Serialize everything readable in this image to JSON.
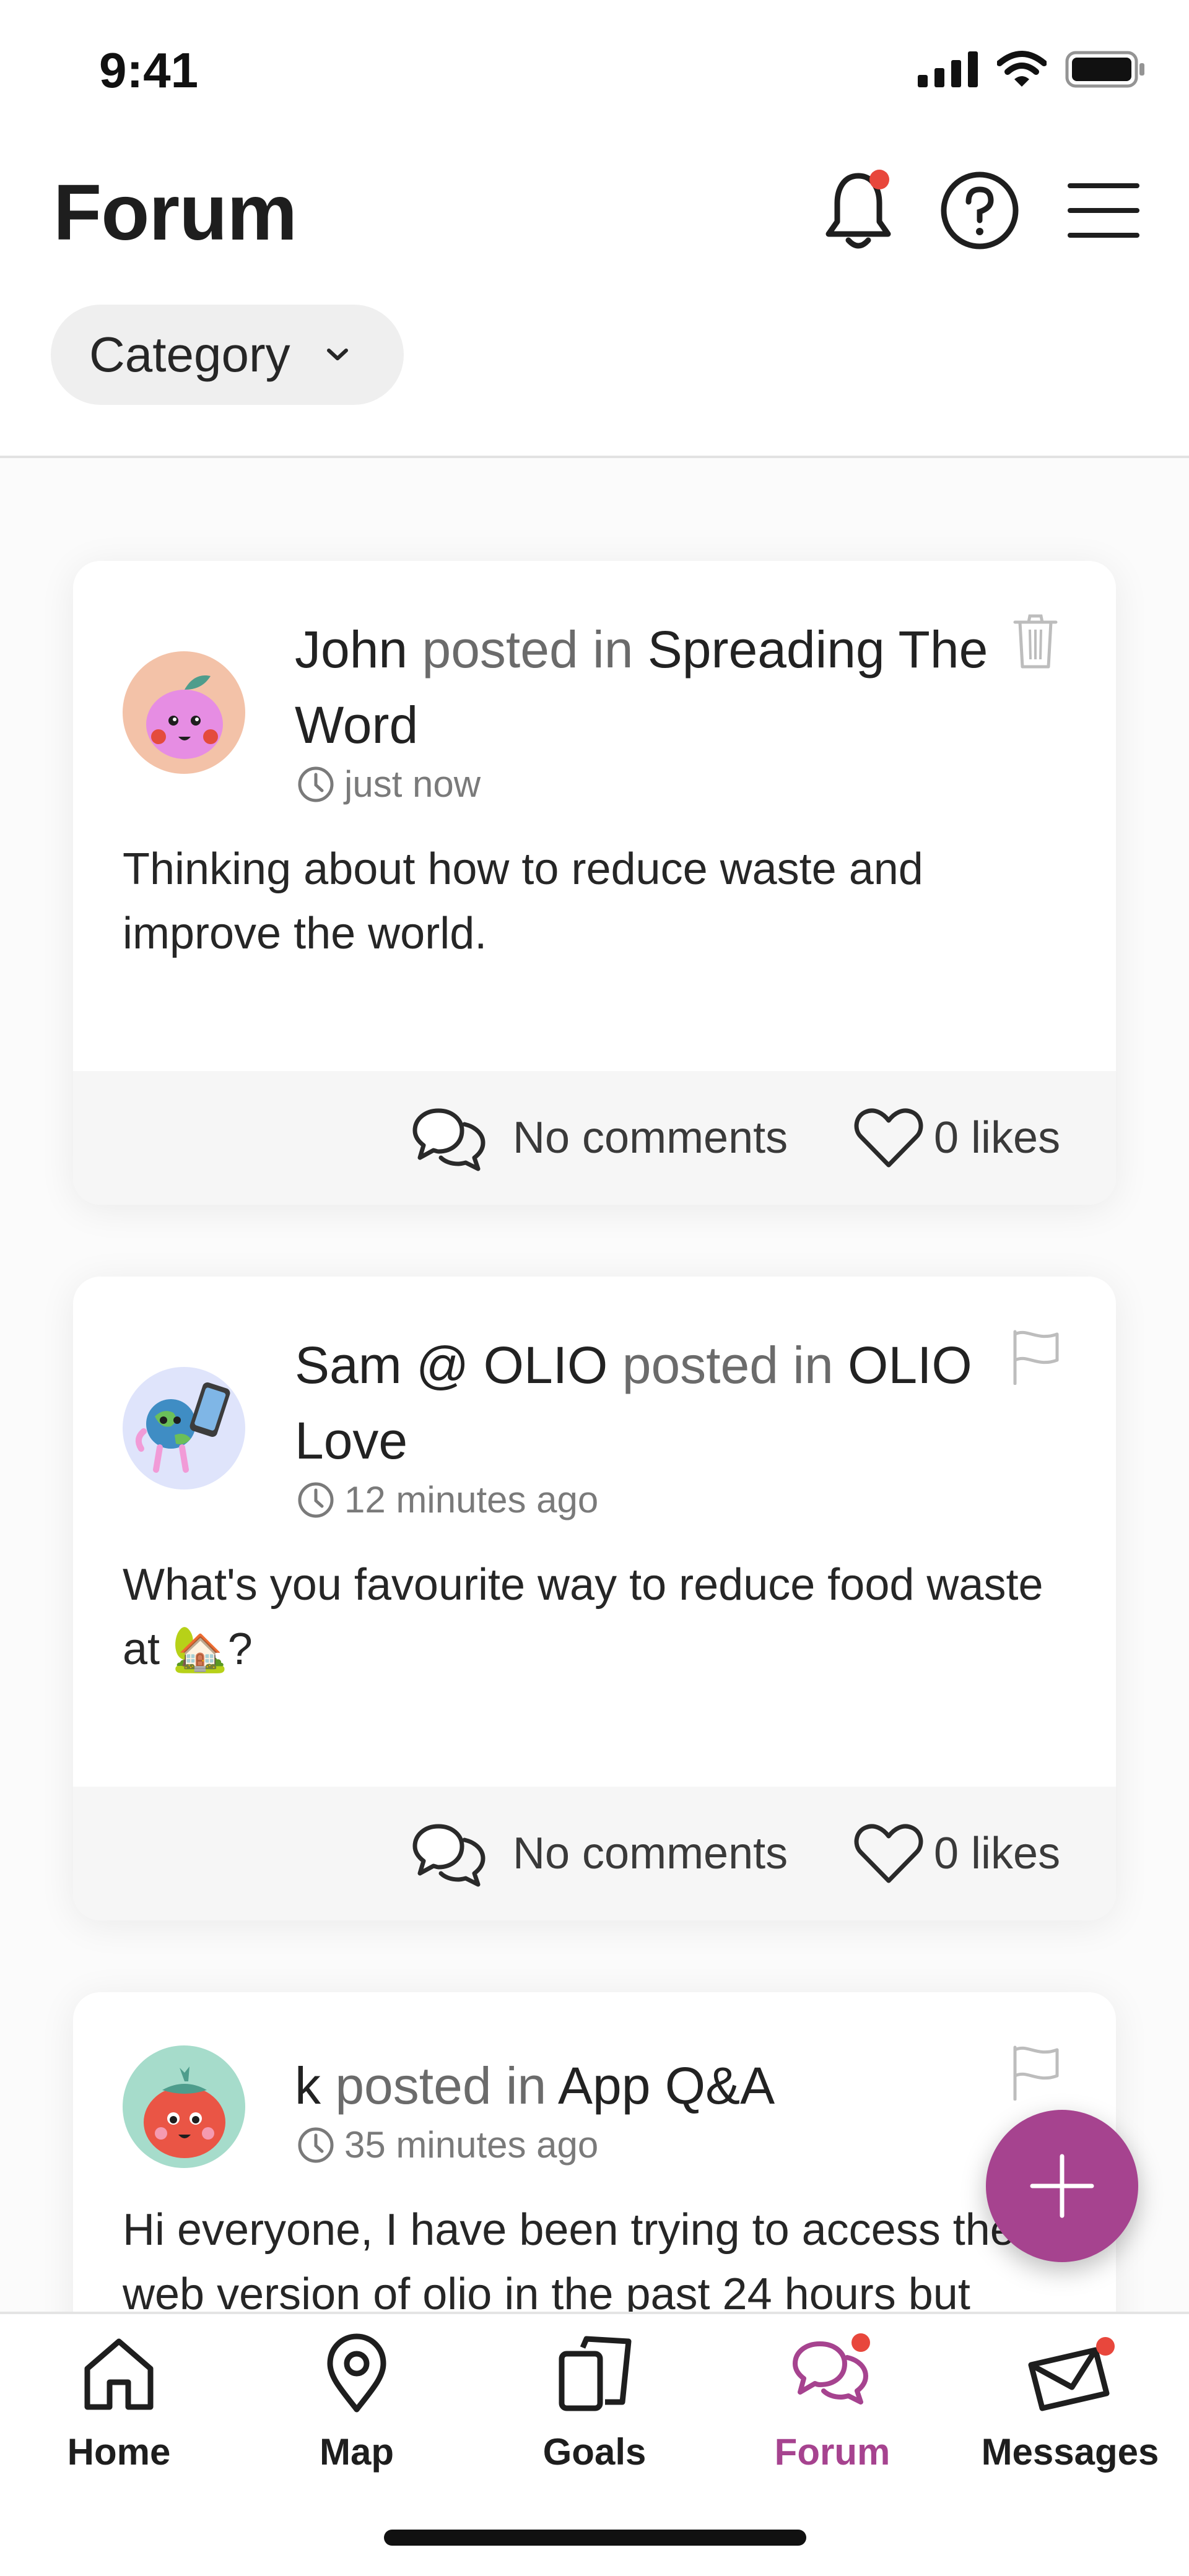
{
  "status_bar": {
    "time": "9:41"
  },
  "header": {
    "title": "Forum"
  },
  "filter": {
    "category_label": "Category"
  },
  "posts": [
    {
      "author": "John",
      "connector": "posted in",
      "category": "Spreading The Word",
      "time": "just now",
      "body": "Thinking about how to reduce waste and improve the world.",
      "comments_label": "No comments",
      "likes_label": "0 likes",
      "corner_icon": "trash-icon"
    },
    {
      "author": "Sam @ OLIO",
      "connector": "posted in",
      "category": "OLIO Love",
      "time": "12 minutes ago",
      "body": "What's you favourite way to reduce food waste at 🏡?",
      "comments_label": "No comments",
      "likes_label": "0 likes",
      "corner_icon": "flag-icon"
    },
    {
      "author": "k",
      "connector": "posted in",
      "category": "App Q&A",
      "time": "35 minutes ago",
      "body": "Hi everyone, I have been trying to access the web version of olio in the past 24 hours but",
      "corner_icon": "flag-icon"
    }
  ],
  "bottom_nav": [
    {
      "label": "Home",
      "icon": "home-icon"
    },
    {
      "label": "Map",
      "icon": "map-pin-icon"
    },
    {
      "label": "Goals",
      "icon": "goals-icon"
    },
    {
      "label": "Forum",
      "icon": "forum-icon",
      "active": true
    },
    {
      "label": "Messages",
      "icon": "messages-icon"
    }
  ],
  "colors": {
    "accent": "#a6438f",
    "badge": "#e8473c"
  }
}
